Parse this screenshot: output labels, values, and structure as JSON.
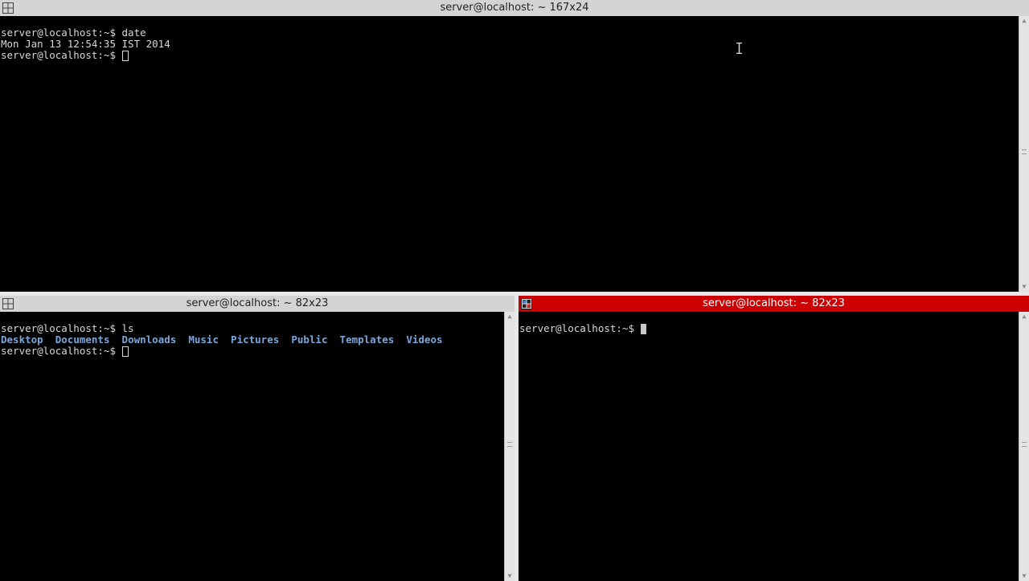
{
  "top": {
    "title": "server@localhost: ~ 167x24",
    "lines": [
      "server@localhost:~$ date",
      "Mon Jan 13 12:54:35 IST 2014"
    ],
    "prompt": "server@localhost:~$ "
  },
  "bottom_left": {
    "title": "server@localhost: ~ 82x23",
    "line1": "server@localhost:~$ ls",
    "dirs": [
      "Desktop",
      "Documents",
      "Downloads",
      "Music",
      "Pictures",
      "Public",
      "Templates",
      "Videos"
    ],
    "prompt": "server@localhost:~$ "
  },
  "bottom_right": {
    "title": "server@localhost: ~ 82x23",
    "prompt": "server@localhost:~$ "
  },
  "colors": {
    "active_title_bg": "#cc0000",
    "inactive_title_bg": "#d4d4d4",
    "terminal_bg": "#000000",
    "terminal_fg": "#d8d8d8",
    "directory_color": "#7aa6da"
  },
  "icons": {
    "window_icon": "split-window-icon",
    "scroll_up": "arrow-up-icon",
    "scroll_down": "arrow-down-icon"
  }
}
